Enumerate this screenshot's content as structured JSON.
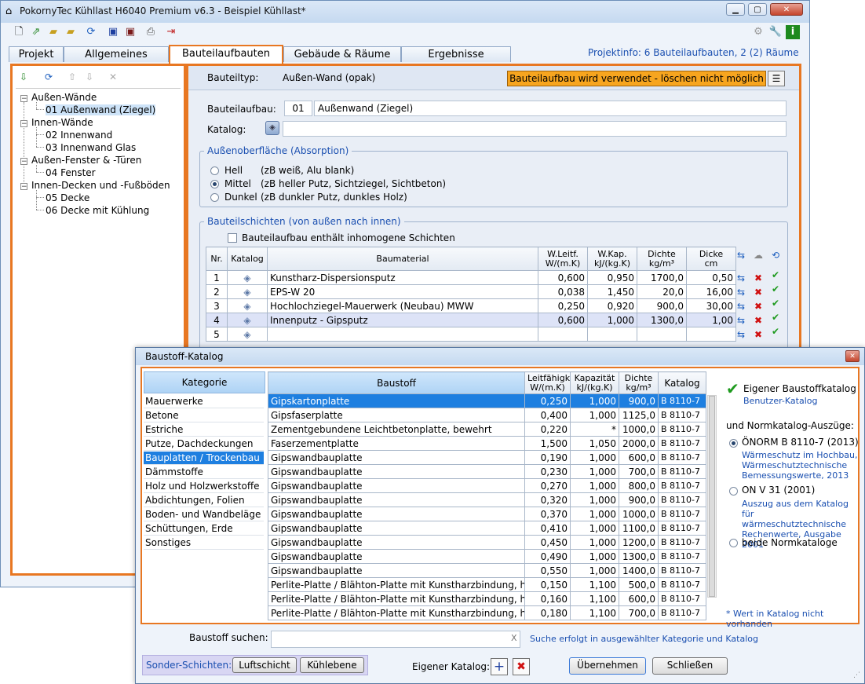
{
  "window": {
    "title": "PokornyTec  Kühllast H6040 Premium v6.3  -  Beispiel Kühllast*"
  },
  "tabs": [
    {
      "label": "Projekt"
    },
    {
      "label": "Allgemeines"
    },
    {
      "label": "Bauteilaufbauten"
    },
    {
      "label": "Gebäude & Räume"
    },
    {
      "label": "Ergebnisse"
    }
  ],
  "projinfo": "Projektinfo: 6 Bauteilaufbauten,  2 (2) Räume",
  "tree": [
    {
      "label": "Außen-Wände"
    },
    {
      "label": "01 Außenwand (Ziegel)"
    },
    {
      "label": "Innen-Wände"
    },
    {
      "label": "02 Innenwand"
    },
    {
      "label": "03 Innenwand Glas"
    },
    {
      "label": "Außen-Fenster & -Türen"
    },
    {
      "label": "04 Fenster"
    },
    {
      "label": "Innen-Decken und -Fußböden"
    },
    {
      "label": "05 Decke"
    },
    {
      "label": "06 Decke mit Kühlung"
    }
  ],
  "bauteil": {
    "typ_label": "Bauteiltyp:",
    "typ_value": "Außen-Wand (opak)",
    "warning": "Bauteilaufbau wird verwendet - löschen nicht möglich",
    "aufbau_label": "Bauteilaufbau:",
    "aufbau_nr": "01",
    "aufbau_name": "Außenwand (Ziegel)",
    "katalog_label": "Katalog:",
    "katalog_value": ""
  },
  "surface": {
    "legend": "Außenoberfläche (Absorption)",
    "options": [
      {
        "label": "Hell",
        "desc": "(zB weiß, Alu blank)"
      },
      {
        "label": "Mittel",
        "desc": "(zB heller Putz, Sichtziegel, Sichtbeton)"
      },
      {
        "label": "Dunkel",
        "desc": "(zB dunkler Putz, dunkles Holz)"
      }
    ]
  },
  "layers": {
    "legend": "Bauteilschichten (von außen nach innen)",
    "inhomogen_label": "Bauteilaufbau enthält inhomogene Schichten",
    "headers": {
      "nr": "Nr.",
      "katalog": "Katalog",
      "material": "Baumaterial",
      "wleit": "W.Leitf.",
      "wleit_unit": "W/(m.K)",
      "wkap": "W.Kap.",
      "wkap_unit": "kJ/(kg.K)",
      "dichte": "Dichte",
      "dichte_unit": "kg/m³",
      "dicke": "Dicke",
      "dicke_unit": "cm"
    },
    "rows": [
      {
        "nr": "1",
        "material": "Kunstharz-Dispersionsputz",
        "wleit": "0,600",
        "wkap": "0,950",
        "dichte": "1700,0",
        "dicke": "0,50"
      },
      {
        "nr": "2",
        "material": "EPS-W 20",
        "wleit": "0,038",
        "wkap": "1,450",
        "dichte": "20,0",
        "dicke": "16,00"
      },
      {
        "nr": "3",
        "material": "Hochlochziegel-Mauerwerk (Neubau) MWW",
        "wleit": "0,250",
        "wkap": "0,920",
        "dichte": "900,0",
        "dicke": "30,00"
      },
      {
        "nr": "4",
        "material": "Innenputz - Gipsputz",
        "wleit": "0,600",
        "wkap": "1,000",
        "dichte": "1300,0",
        "dicke": "1,00"
      },
      {
        "nr": "5",
        "material": "",
        "wleit": "",
        "wkap": "",
        "dichte": "",
        "dicke": ""
      }
    ]
  },
  "dialog": {
    "title": "Baustoff-Katalog",
    "kategorie_header": "Kategorie",
    "categories": [
      "Mauerwerke",
      "Betone",
      "Estriche",
      "Putze, Dachdeckungen",
      "Bauplatten / Trockenbau",
      "Dämmstoffe",
      "Holz und Holzwerkstoffe",
      "Abdichtungen, Folien",
      "Boden- und Wandbeläge",
      "Schüttungen, Erde",
      "Sonstiges"
    ],
    "headers": {
      "baustoff": "Baustoff",
      "leit": "Leitfähigk",
      "leit_unit": "W/(m.K)",
      "kap": "Kapazität",
      "kap_unit": "kJ/(kg.K)",
      "dichte": "Dichte",
      "dichte_unit": "kg/m³",
      "katalog": "Katalog"
    },
    "materials": [
      {
        "name": "Gipskartonplatte",
        "leit": "0,250",
        "kap": "1,000",
        "dichte": "900,0",
        "kat": "B 8110-7"
      },
      {
        "name": "Gipsfaserplatte",
        "leit": "0,400",
        "kap": "1,000",
        "dichte": "1125,0",
        "kat": "B 8110-7"
      },
      {
        "name": "Zementgebundene Leichtbetonplatte, bewehrt",
        "leit": "0,220",
        "kap": "*",
        "dichte": "1000,0",
        "kat": "B 8110-7"
      },
      {
        "name": "Faserzementplatte",
        "leit": "1,500",
        "kap": "1,050",
        "dichte": "2000,0",
        "kat": "B 8110-7"
      },
      {
        "name": "Gipswandbauplatte",
        "leit": "0,190",
        "kap": "1,000",
        "dichte": "600,0",
        "kat": "B 8110-7"
      },
      {
        "name": "Gipswandbauplatte",
        "leit": "0,230",
        "kap": "1,000",
        "dichte": "700,0",
        "kat": "B 8110-7"
      },
      {
        "name": "Gipswandbauplatte",
        "leit": "0,270",
        "kap": "1,000",
        "dichte": "800,0",
        "kat": "B 8110-7"
      },
      {
        "name": "Gipswandbauplatte",
        "leit": "0,320",
        "kap": "1,000",
        "dichte": "900,0",
        "kat": "B 8110-7"
      },
      {
        "name": "Gipswandbauplatte",
        "leit": "0,370",
        "kap": "1,000",
        "dichte": "1000,0",
        "kat": "B 8110-7"
      },
      {
        "name": "Gipswandbauplatte",
        "leit": "0,410",
        "kap": "1,000",
        "dichte": "1100,0",
        "kat": "B 8110-7"
      },
      {
        "name": "Gipswandbauplatte",
        "leit": "0,450",
        "kap": "1,000",
        "dichte": "1200,0",
        "kat": "B 8110-7"
      },
      {
        "name": "Gipswandbauplatte",
        "leit": "0,490",
        "kap": "1,000",
        "dichte": "1300,0",
        "kat": "B 8110-7"
      },
      {
        "name": "Gipswandbauplatte",
        "leit": "0,550",
        "kap": "1,000",
        "dichte": "1400,0",
        "kat": "B 8110-7"
      },
      {
        "name": "Perlite-Platte / Blähton-Platte mit Kunstharzbindung, hi...",
        "leit": "0,150",
        "kap": "1,100",
        "dichte": "500,0",
        "kat": "B 8110-7"
      },
      {
        "name": "Perlite-Platte / Blähton-Platte mit Kunstharzbindung, hi...",
        "leit": "0,160",
        "kap": "1,100",
        "dichte": "600,0",
        "kat": "B 8110-7"
      },
      {
        "name": "Perlite-Platte / Blähton-Platte mit Kunstharzbindung, hi...",
        "leit": "0,180",
        "kap": "1,100",
        "dichte": "700,0",
        "kat": "B 8110-7"
      }
    ],
    "own_catalog": "Eigener Baustoffkatalog",
    "own_catalog_sub": "Benutzer-Katalog",
    "norm_label": "und Normkatalog-Auszüge:",
    "norm_options": [
      {
        "label": "ÖNORM B 8110-7 (2013)",
        "desc": "Wärmeschutz im Hochbau, Wärmeschutztechnische Bemessungswerte, 2013"
      },
      {
        "label": "ON V 31 (2001)",
        "desc": "Auszug aus dem Katalog für wärmeschutztechnische Rechenwerte, Ausgabe 2001"
      },
      {
        "label": "beide Normkataloge",
        "desc": ""
      }
    ],
    "footnote": "* Wert in Katalog nicht vorhanden",
    "search_label": "Baustoff suchen:",
    "search_value": "",
    "search_hint": "Suche erfolgt in ausgewählter Kategorie und Katalog",
    "sonder_label": "Sonder-Schichten:",
    "btn_luft": "Luftschicht",
    "btn_kuehl": "Kühlebene",
    "eigener_label": "Eigener Katalog:",
    "btn_ok": "Übernehmen",
    "btn_close": "Schließen"
  }
}
